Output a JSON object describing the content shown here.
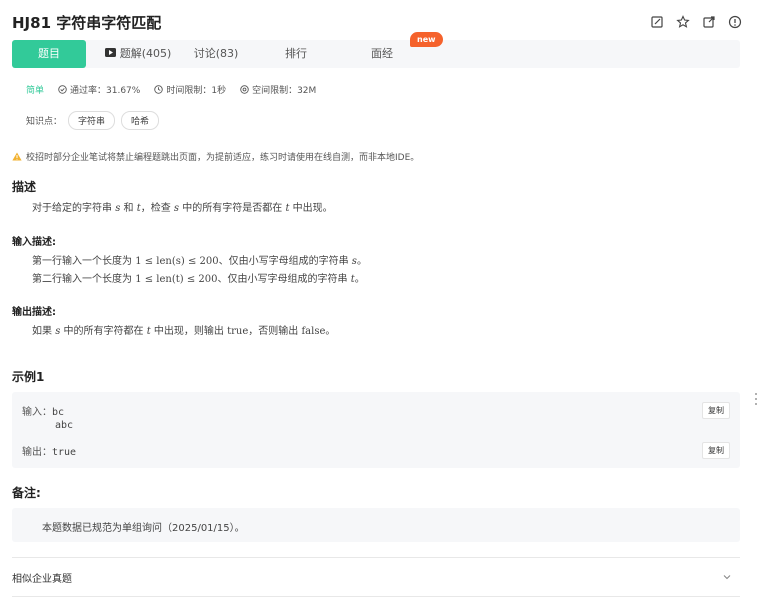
{
  "header": {
    "title": "HJ81  字符串字符匹配",
    "icons": [
      "edit-icon",
      "star-icon",
      "share-icon",
      "report-icon"
    ]
  },
  "tabs": [
    {
      "label": "题目",
      "active": true
    },
    {
      "label": "题解(405)",
      "active": false
    },
    {
      "label": "讨论(83)",
      "active": false
    },
    {
      "label": "排行",
      "active": false
    },
    {
      "label": "面经",
      "active": false
    }
  ],
  "new_badge": "new",
  "meta": {
    "level": "简单",
    "pass_rate": "通过率：31.67%",
    "time_limit": "时间限制：1秒",
    "space_limit": "空间限制：32M"
  },
  "knowledge": {
    "label": "知识点：",
    "tags": [
      "字符串",
      "哈希"
    ]
  },
  "warning": "校招时部分企业笔试将禁止编程题跳出页面，为提前适应，练习时请使用在线自测，而非本地IDE。",
  "description": {
    "heading": "描述",
    "text_a": "对于给定的字符串",
    "s": "s",
    "and": "和",
    "t": "t",
    "text_b": "，检查",
    "text_c": "中的所有字符是否都在",
    "text_d": "中出现。"
  },
  "input_desc": {
    "heading": "输入描述:",
    "line1_a": "第一行输入一个长度为",
    "line1_math": "1 ≤ len(s) ≤ 200",
    "line1_b": "、仅由小写字母组成的字符串",
    "line1_var": "s",
    "line2_a": "第二行输入一个长度为",
    "line2_math": "1 ≤ len(t) ≤ 200",
    "line2_b": "、仅由小写字母组成的字符串",
    "line2_var": "t",
    "period": "。"
  },
  "output_desc": {
    "heading": "输出描述:",
    "text_a": "如果",
    "s": "s",
    "text_b": "中的所有字符都在",
    "t": "t",
    "text_c": "中出现，则输出",
    "true": "true",
    "text_d": "，否则输出",
    "false": "false",
    "text_e": "。"
  },
  "example": {
    "heading": "示例1",
    "input_label": "输入：",
    "input_line1": "bc",
    "input_line2": "abc",
    "output_label": "输出：",
    "output_value": "true",
    "copy_label": "复制"
  },
  "note": {
    "heading": "备注:",
    "text": "本题数据已规范为单组询问（2025/01/15）。"
  },
  "similar": {
    "label": "相似企业真题"
  },
  "colors": {
    "accent": "#32ca99",
    "badge": "#f5622c"
  }
}
